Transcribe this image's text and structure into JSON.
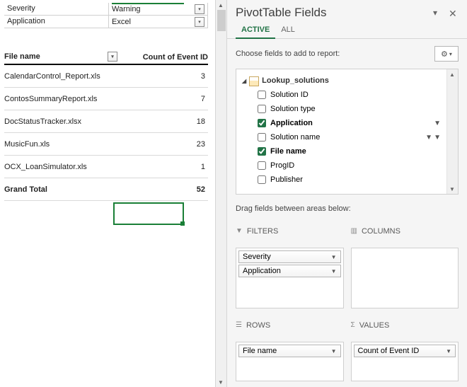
{
  "slicers": [
    {
      "label": "Severity",
      "value": "Warning"
    },
    {
      "label": "Application",
      "value": "Excel"
    }
  ],
  "table": {
    "col1": "File name",
    "col2": "Count of Event ID",
    "rows": [
      {
        "name": "CalendarControl_Report.xls",
        "count": 3
      },
      {
        "name": "ContosSummaryReport.xls",
        "count": 7
      },
      {
        "name": "DocStatusTracker.xlsx",
        "count": 18
      },
      {
        "name": "MusicFun.xls",
        "count": 23
      },
      {
        "name": "OCX_LoanSimulator.xls",
        "count": 1
      }
    ],
    "total_label": "Grand Total",
    "total_value": 52
  },
  "pane": {
    "title": "PivotTable Fields",
    "tab_active": "ACTIVE",
    "tab_all": "ALL",
    "choose": "Choose fields to add to report:",
    "root": "Lookup_solutions",
    "fields": [
      {
        "label": "Solution ID",
        "checked": false,
        "filter": false
      },
      {
        "label": "Solution type",
        "checked": false,
        "filter": false
      },
      {
        "label": "Application",
        "checked": true,
        "filter": true
      },
      {
        "label": "Solution name",
        "checked": false,
        "filter": true,
        "extra_filter": true
      },
      {
        "label": "File name",
        "checked": true,
        "filter": false
      },
      {
        "label": "ProgID",
        "checked": false,
        "filter": false
      },
      {
        "label": "Publisher",
        "checked": false,
        "filter": false
      }
    ],
    "drag": "Drag fields between areas below:",
    "area_filters": "FILTERS",
    "area_columns": "COLUMNS",
    "area_rows": "ROWS",
    "area_values": "VALUES",
    "filters_items": [
      "Severity",
      "Application"
    ],
    "rows_items": [
      "File name"
    ],
    "values_items": [
      "Count of Event ID"
    ]
  }
}
